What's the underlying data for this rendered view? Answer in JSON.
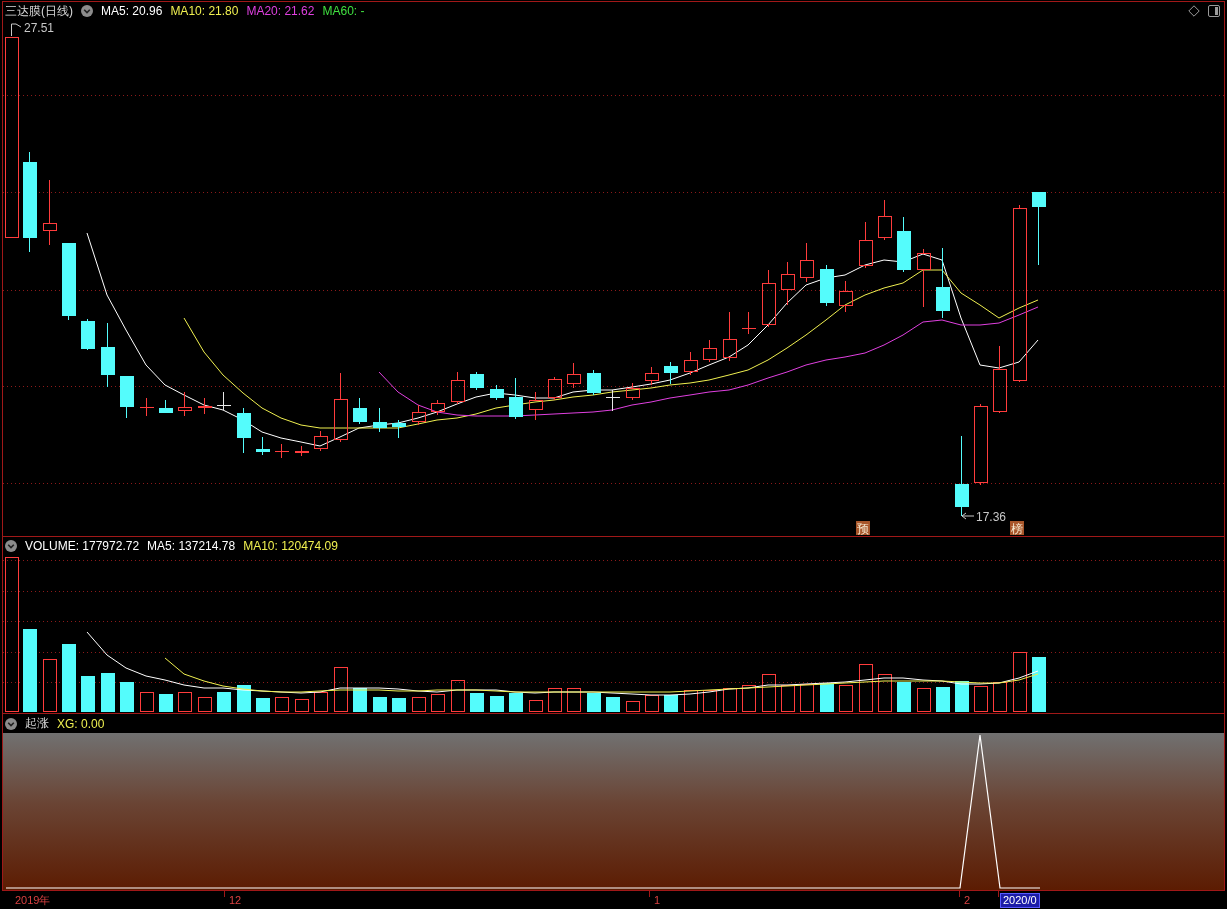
{
  "price_panel": {
    "title": "三达膜(日线)",
    "indicators": [
      {
        "label": "MA5: 20.96",
        "color": "#ffffff"
      },
      {
        "label": "MA10: 21.80",
        "color": "#f0f050"
      },
      {
        "label": "MA20: 21.62",
        "color": "#e040e0"
      },
      {
        "label": "MA60: -",
        "color": "#40e040"
      }
    ],
    "high_label": "27.51",
    "low_label": "17.36",
    "event_markers": [
      {
        "label": "预"
      },
      {
        "label": "榜"
      }
    ]
  },
  "volume_panel": {
    "indicators": [
      {
        "label": "VOLUME: 177972.72",
        "color": "#ffffff"
      },
      {
        "label": "MA5: 137214.78",
        "color": "#ffffff"
      },
      {
        "label": "MA10: 120474.09",
        "color": "#f0f050"
      }
    ]
  },
  "signal_panel": {
    "title": "起涨",
    "indicators": [
      {
        "label": "XG: 0.00",
        "color": "#f0f050"
      }
    ]
  },
  "time_axis": {
    "labels": [
      {
        "label": "2019年",
        "highlighted": false
      },
      {
        "label": "12",
        "highlighted": false
      },
      {
        "label": "1",
        "highlighted": false
      },
      {
        "label": "2",
        "highlighted": false
      },
      {
        "label": "2020/0",
        "highlighted": true
      }
    ]
  }
}
